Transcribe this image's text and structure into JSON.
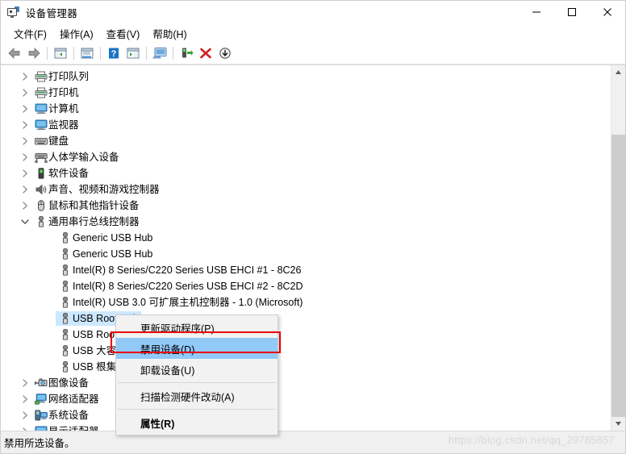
{
  "window": {
    "title": "设备管理器",
    "icon": "device-manager-icon",
    "controls": {
      "minimize": "—",
      "maximize": "☐",
      "close": "✕"
    }
  },
  "menubar": {
    "items": [
      {
        "label": "文件(F)",
        "name": "menu-file"
      },
      {
        "label": "操作(A)",
        "name": "menu-action"
      },
      {
        "label": "查看(V)",
        "name": "menu-view"
      },
      {
        "label": "帮助(H)",
        "name": "menu-help"
      }
    ]
  },
  "toolbar": {
    "buttons": [
      {
        "name": "back-icon",
        "tip": "后退"
      },
      {
        "name": "forward-icon",
        "tip": "前进"
      },
      {
        "name": "show-hide-console-tree-icon",
        "tip": "显示/隐藏控制台树"
      },
      {
        "name": "properties-icon",
        "tip": "属性"
      },
      {
        "name": "help-icon",
        "tip": "帮助"
      },
      {
        "name": "show-hide-action-pane-icon",
        "tip": "显示/隐藏操作窗格"
      },
      {
        "name": "scan-hardware-changes-icon",
        "tip": "扫描检测硬件改动"
      },
      {
        "name": "update-driver-icon",
        "tip": "更新驱动程序"
      },
      {
        "name": "uninstall-device-icon",
        "tip": "卸载设备"
      },
      {
        "name": "disable-device-icon",
        "tip": "禁用设备"
      }
    ]
  },
  "tree": {
    "rows": [
      {
        "label": "打印队列",
        "level": 1,
        "icon": "printer-icon",
        "expander": "collapsed",
        "selected": false
      },
      {
        "label": "打印机",
        "level": 1,
        "icon": "printer-icon",
        "expander": "collapsed",
        "selected": false
      },
      {
        "label": "计算机",
        "level": 1,
        "icon": "computer-icon",
        "expander": "collapsed",
        "selected": false
      },
      {
        "label": "监视器",
        "level": 1,
        "icon": "monitor-icon",
        "expander": "collapsed",
        "selected": false
      },
      {
        "label": "键盘",
        "level": 1,
        "icon": "keyboard-icon",
        "expander": "collapsed",
        "selected": false
      },
      {
        "label": "人体学输入设备",
        "level": 1,
        "icon": "hid-icon",
        "expander": "collapsed",
        "selected": false
      },
      {
        "label": "软件设备",
        "level": 1,
        "icon": "software-device-icon",
        "expander": "collapsed",
        "selected": false
      },
      {
        "label": "声音、视频和游戏控制器",
        "level": 1,
        "icon": "speaker-icon",
        "expander": "collapsed",
        "selected": false
      },
      {
        "label": "鼠标和其他指针设备",
        "level": 1,
        "icon": "mouse-icon",
        "expander": "collapsed",
        "selected": false
      },
      {
        "label": "通用串行总线控制器",
        "level": 1,
        "icon": "usb-icon",
        "expander": "expanded",
        "selected": false
      },
      {
        "label": "Generic USB Hub",
        "level": 2,
        "icon": "usb-icon",
        "expander": "none",
        "selected": false
      },
      {
        "label": "Generic USB Hub",
        "level": 2,
        "icon": "usb-icon",
        "expander": "none",
        "selected": false
      },
      {
        "label": "Intel(R) 8 Series/C220 Series USB EHCI #1 - 8C26",
        "level": 2,
        "icon": "usb-icon",
        "expander": "none",
        "selected": false
      },
      {
        "label": "Intel(R) 8 Series/C220 Series USB EHCI #2 - 8C2D",
        "level": 2,
        "icon": "usb-icon",
        "expander": "none",
        "selected": false
      },
      {
        "label": "Intel(R) USB 3.0 可扩展主机控制器 - 1.0 (Microsoft)",
        "level": 2,
        "icon": "usb-icon",
        "expander": "none",
        "selected": false
      },
      {
        "label": "USB Root Hub",
        "level": 2,
        "icon": "usb-icon",
        "expander": "none",
        "selected": true
      },
      {
        "label": "USB Root Hub",
        "level": 2,
        "icon": "usb-icon",
        "expander": "none",
        "selected": false
      },
      {
        "label": "USB 大容量存储设备",
        "level": 2,
        "icon": "usb-icon",
        "expander": "none",
        "selected": false
      },
      {
        "label": "USB 根集线器",
        "level": 2,
        "icon": "usb-icon",
        "expander": "none",
        "selected": false
      },
      {
        "label": "图像设备",
        "level": 1,
        "icon": "imaging-icon",
        "expander": "collapsed",
        "selected": false
      },
      {
        "label": "网络适配器",
        "level": 1,
        "icon": "network-icon",
        "expander": "collapsed",
        "selected": false
      },
      {
        "label": "系统设备",
        "level": 1,
        "icon": "system-device-icon",
        "expander": "collapsed",
        "selected": false
      },
      {
        "label": "显示适配器",
        "level": 1,
        "icon": "display-adapter-icon",
        "expander": "collapsed",
        "selected": false
      }
    ]
  },
  "context_menu": {
    "items": [
      {
        "label": "更新驱动程序(P)",
        "name": "ctx-update-driver",
        "highlighted": false,
        "bold": false,
        "separator_after": false
      },
      {
        "label": "禁用设备(D)",
        "name": "ctx-disable-device",
        "highlighted": true,
        "bold": false,
        "separator_after": false
      },
      {
        "label": "卸载设备(U)",
        "name": "ctx-uninstall-device",
        "highlighted": false,
        "bold": false,
        "separator_after": true
      },
      {
        "label": "扫描检测硬件改动(A)",
        "name": "ctx-scan-hardware",
        "highlighted": false,
        "bold": false,
        "separator_after": true
      },
      {
        "label": "属性(R)",
        "name": "ctx-properties",
        "highlighted": false,
        "bold": true,
        "separator_after": false
      }
    ]
  },
  "statusbar": {
    "text": "禁用所选设备。"
  },
  "watermark": {
    "text": "https://blog.csdn.net/qq_29785857"
  },
  "scrollbar": {
    "up_arrow": "▲",
    "down_arrow": "▼"
  },
  "colors": {
    "selection": "#cce8ff",
    "menu_highlight": "#91c9f7",
    "annotation_red": "#e8000d",
    "window_bg": "#f0f0f0"
  }
}
